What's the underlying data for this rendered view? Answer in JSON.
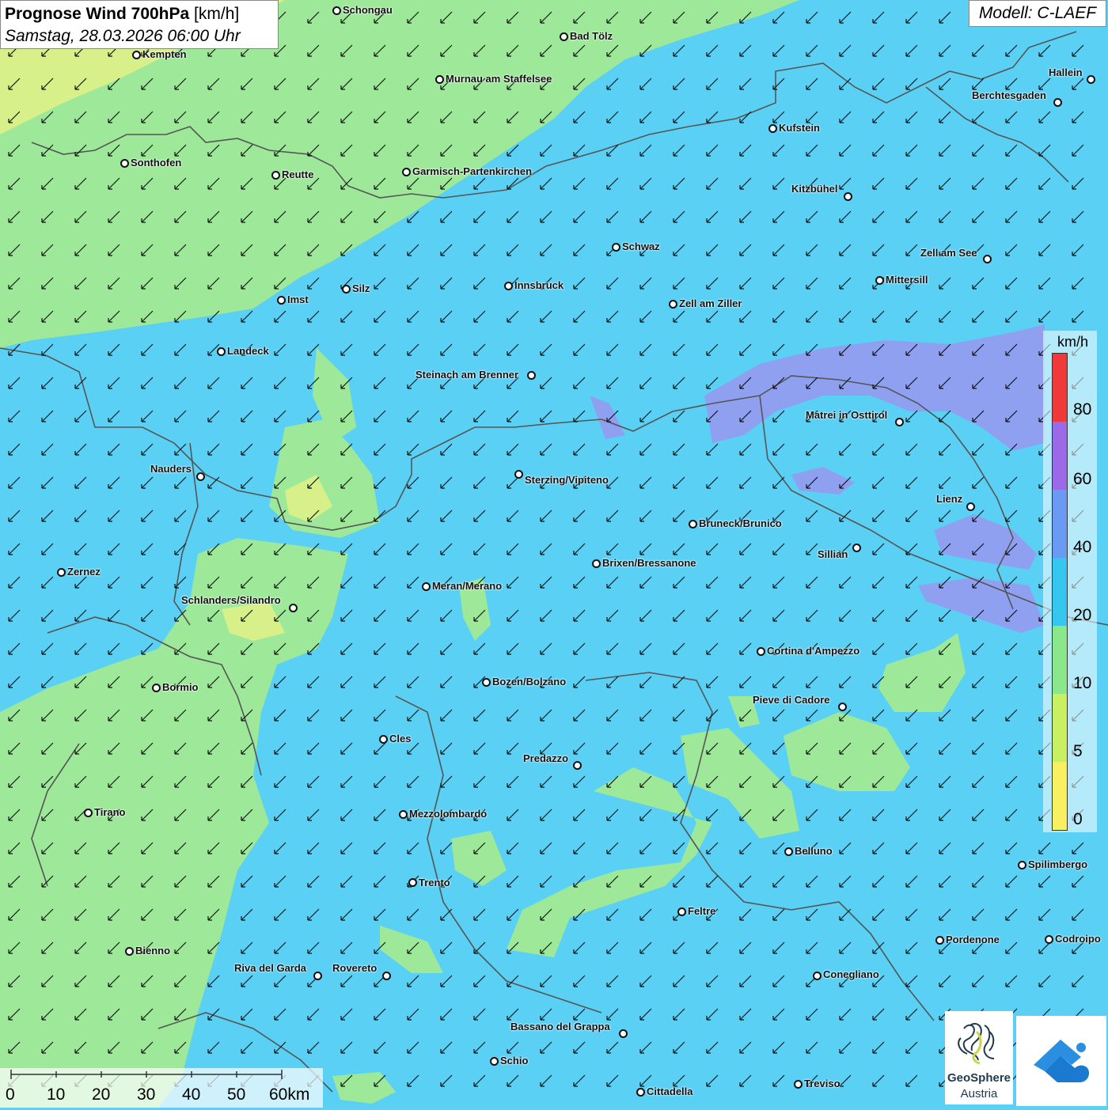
{
  "header": {
    "title_bold": "Prognose Wind 700hPa",
    "title_unit": " [km/h]",
    "subtitle": "Samstag, 28.03.2026 06:00 Uhr"
  },
  "model_label": "Modell: C-LAEF",
  "legend": {
    "unit": "km/h",
    "ticks": [
      "80",
      "60",
      "40",
      "20",
      "10",
      "5",
      "0"
    ],
    "colors": [
      "#f03a3a",
      "#9a6ae8",
      "#6a9af2",
      "#35c7f0",
      "#8ae88a",
      "#c8f060",
      "#f8f060"
    ]
  },
  "scalebar": {
    "labels": [
      "0",
      "10",
      "20",
      "30",
      "40",
      "50",
      "60km"
    ]
  },
  "logos": {
    "geosphere_line1": "GeoSphere",
    "geosphere_line2": "Austria"
  },
  "colors": {
    "green_zone": "#9ee89a",
    "blue_zone": "#5ad0f4",
    "violet_zone": "#8fa0f0",
    "yellow_zone": "#d8f08a",
    "border": "#555555",
    "arrow": "#111111"
  },
  "cities": [
    {
      "name": "Schongau"
    },
    {
      "name": "Bad Tölz"
    },
    {
      "name": "Kempten"
    },
    {
      "name": "Murnau am Staffelsee"
    },
    {
      "name": "Hallein"
    },
    {
      "name": "Berchtesgaden"
    },
    {
      "name": "Kufstein"
    },
    {
      "name": "Sonthofen"
    },
    {
      "name": "Reutte"
    },
    {
      "name": "Garmisch-Partenkirchen"
    },
    {
      "name": "Kitzbühel"
    },
    {
      "name": "Schwaz"
    },
    {
      "name": "Zell am See"
    },
    {
      "name": "Mittersill"
    },
    {
      "name": "Imst"
    },
    {
      "name": "Silz"
    },
    {
      "name": "Innsbruck"
    },
    {
      "name": "Zell am Ziller"
    },
    {
      "name": "Landeck"
    },
    {
      "name": "Steinach am Brenner"
    },
    {
      "name": "Matrei in Osttirol"
    },
    {
      "name": "Nauders"
    },
    {
      "name": "Sterzing/Vipiteno"
    },
    {
      "name": "Lienz"
    },
    {
      "name": "Bruneck/Brunico"
    },
    {
      "name": "Sillian"
    },
    {
      "name": "Brixen/Bressanone"
    },
    {
      "name": "Zernez"
    },
    {
      "name": "Meran/Merano"
    },
    {
      "name": "Schlanders/Silandro"
    },
    {
      "name": "Cortina d'Ampezzo"
    },
    {
      "name": "Bozen/Bolzano"
    },
    {
      "name": "Bormio"
    },
    {
      "name": "Pieve di Cadore"
    },
    {
      "name": "Cles"
    },
    {
      "name": "Predazzo"
    },
    {
      "name": "Tirano"
    },
    {
      "name": "Mezzolombardo"
    },
    {
      "name": "Belluno"
    },
    {
      "name": "Spilimbergo"
    },
    {
      "name": "Trento"
    },
    {
      "name": "Feltre"
    },
    {
      "name": "Pordenone"
    },
    {
      "name": "Codroipo"
    },
    {
      "name": "Bienno"
    },
    {
      "name": "Riva del Garda"
    },
    {
      "name": "Rovereto"
    },
    {
      "name": "Conegliano"
    },
    {
      "name": "Bassano del Grappa"
    },
    {
      "name": "Schio"
    },
    {
      "name": "Treviso"
    },
    {
      "name": "Cittadella"
    }
  ]
}
